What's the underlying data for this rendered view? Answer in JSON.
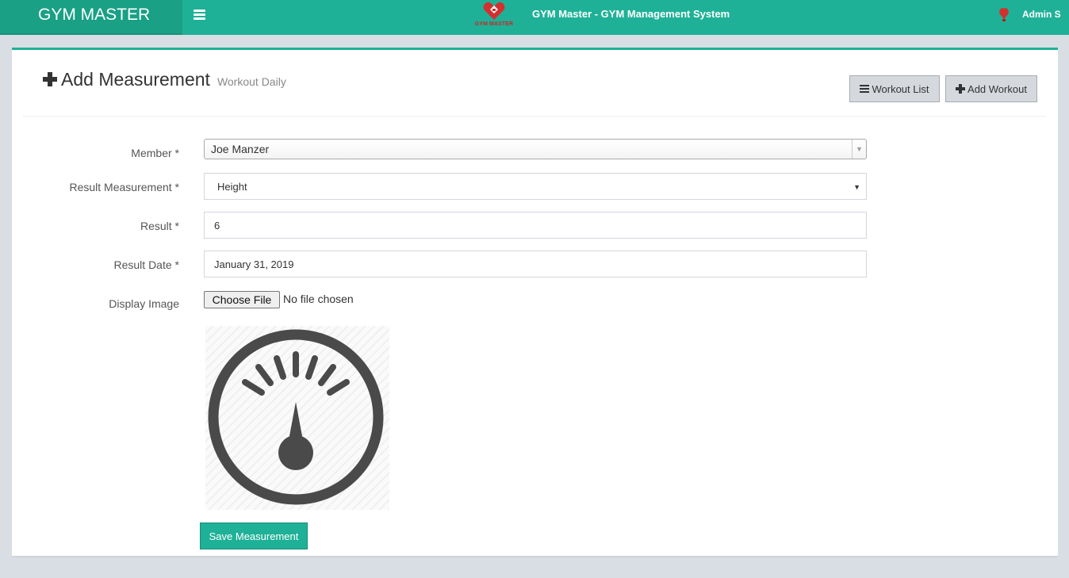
{
  "header": {
    "brand": "GYM MASTER",
    "logo_text": "GYM MASTER",
    "app_title": "GYM Master - GYM Management System",
    "user_name": "Admin S",
    "accent_color": "#1fb197"
  },
  "page": {
    "title": "Add Measurement",
    "subtitle": "Workout Daily",
    "buttons": {
      "workout_list": "Workout List",
      "add_workout": "Add Workout"
    }
  },
  "form": {
    "member": {
      "label": "Member",
      "required": "*",
      "value": "Joe Manzer"
    },
    "result_measurement": {
      "label": "Result Measurement",
      "required": "*",
      "value": "Height"
    },
    "result": {
      "label": "Result",
      "required": "*",
      "value": "6"
    },
    "result_date": {
      "label": "Result Date",
      "required": "*",
      "value": "January 31, 2019"
    },
    "display_image": {
      "label": "Display Image",
      "button": "Choose File",
      "status": "No file chosen",
      "preview_icon": "weight-scale-gauge-icon"
    },
    "save_button": "Save Measurement"
  }
}
